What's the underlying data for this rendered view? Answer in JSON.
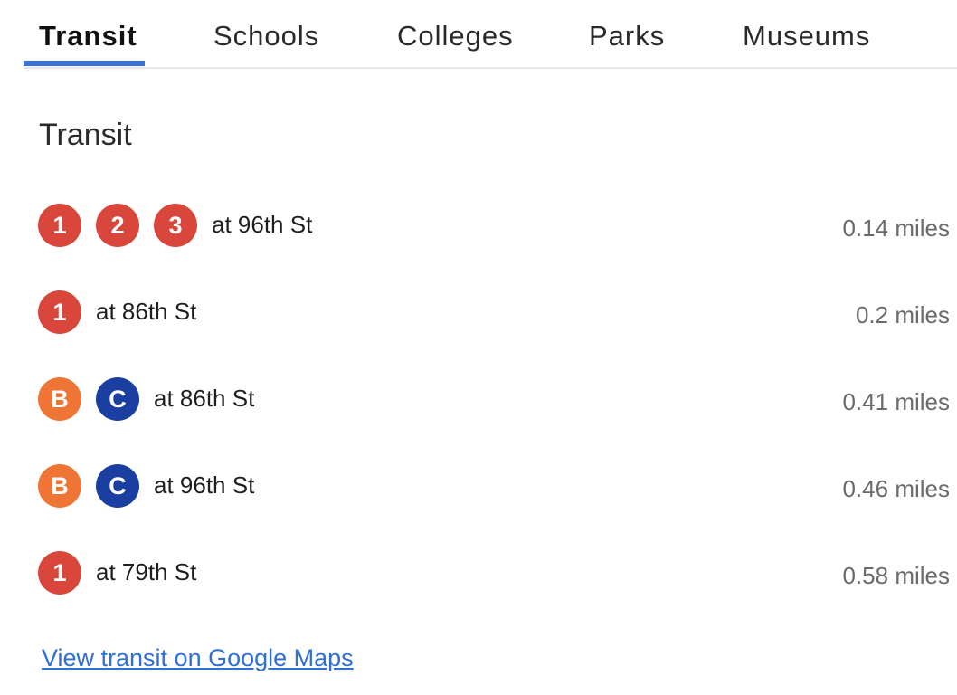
{
  "tabs": [
    {
      "label": "Transit",
      "active": true
    },
    {
      "label": "Schools",
      "active": false
    },
    {
      "label": "Colleges",
      "active": false
    },
    {
      "label": "Parks",
      "active": false
    },
    {
      "label": "Museums",
      "active": false
    }
  ],
  "section_title": "Transit",
  "colors": {
    "accent": "#3b73d6",
    "red_line": "#d9463b",
    "orange_line": "#ef7537",
    "blue_line": "#1a3fa0",
    "distance_text": "#6b6b6b",
    "link": "#2f6fd6"
  },
  "stations": [
    {
      "lines": [
        {
          "label": "1",
          "color": "#d9463b"
        },
        {
          "label": "2",
          "color": "#d9463b"
        },
        {
          "label": "3",
          "color": "#d9463b"
        }
      ],
      "stop": "at 96th St",
      "distance": "0.14 miles"
    },
    {
      "lines": [
        {
          "label": "1",
          "color": "#d9463b"
        }
      ],
      "stop": "at 86th St",
      "distance": "0.2 miles"
    },
    {
      "lines": [
        {
          "label": "B",
          "color": "#ef7537"
        },
        {
          "label": "C",
          "color": "#1a3fa0"
        }
      ],
      "stop": "at 86th St",
      "distance": "0.41 miles"
    },
    {
      "lines": [
        {
          "label": "B",
          "color": "#ef7537"
        },
        {
          "label": "C",
          "color": "#1a3fa0"
        }
      ],
      "stop": "at 96th St",
      "distance": "0.46 miles"
    },
    {
      "lines": [
        {
          "label": "1",
          "color": "#d9463b"
        }
      ],
      "stop": "at 79th St",
      "distance": "0.58 miles"
    }
  ],
  "map_link_label": "View transit on Google Maps"
}
